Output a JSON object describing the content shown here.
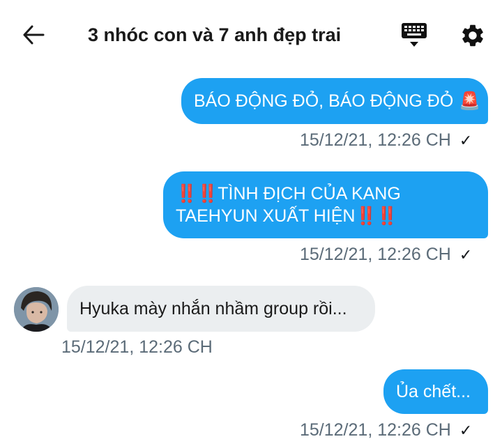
{
  "header": {
    "title": "3 nhóc con và 7 anh đẹp trai",
    "back_icon": "arrow-left-icon",
    "keyboard_icon": "keyboard-icon",
    "settings_icon": "gear-icon"
  },
  "messages": [
    {
      "direction": "outgoing",
      "text": "BÁO ĐỘNG ĐỎ, BÁO ĐỘNG ĐỎ",
      "emoji": "🚨",
      "time": "15/12/21, 12:26 CH",
      "seen": true
    },
    {
      "direction": "outgoing",
      "prefix": "‼️‼️",
      "line1": "TÌNH ĐỊCH CỦA KANG",
      "line2": "TAEHYUN XUẤT HIỆN",
      "suffix": "‼️‼️",
      "time": "15/12/21, 12:26 CH",
      "seen": true
    },
    {
      "direction": "incoming",
      "text": "Hyuka mày nhắn nhầm group rồi...",
      "time": "15/12/21, 12:26 CH"
    },
    {
      "direction": "outgoing",
      "text": "Ủa chết...",
      "time": "15/12/21, 12:26 CH",
      "seen": true
    }
  ],
  "colors": {
    "outgoing_bubble": "#1da1f2",
    "incoming_bubble": "#ebeef0",
    "timestamp": "#5b6b78"
  }
}
